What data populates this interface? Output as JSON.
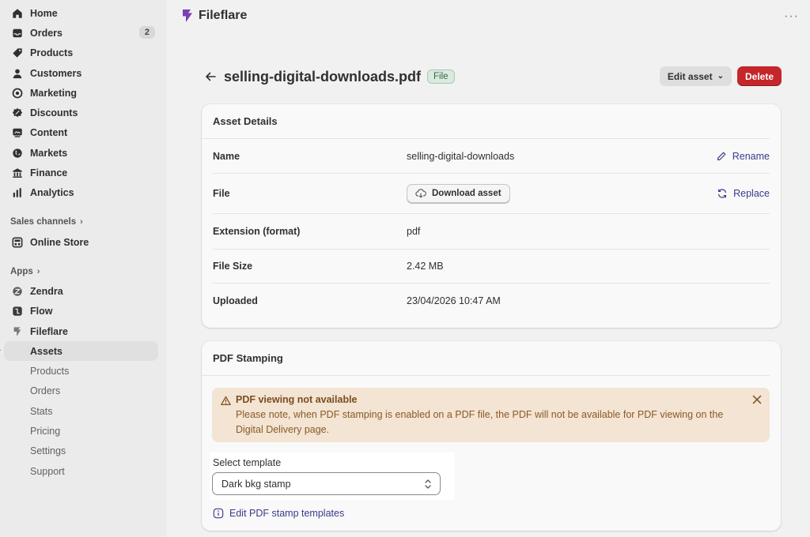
{
  "sidebar": {
    "items": [
      {
        "label": "Home",
        "icon": "home-icon"
      },
      {
        "label": "Orders",
        "icon": "inbox-icon",
        "badge": "2"
      },
      {
        "label": "Products",
        "icon": "tag-icon"
      },
      {
        "label": "Customers",
        "icon": "person-icon"
      },
      {
        "label": "Marketing",
        "icon": "target-icon"
      },
      {
        "label": "Discounts",
        "icon": "discount-icon"
      },
      {
        "label": "Content",
        "icon": "content-icon"
      },
      {
        "label": "Markets",
        "icon": "globe-icon"
      },
      {
        "label": "Finance",
        "icon": "bank-icon"
      },
      {
        "label": "Analytics",
        "icon": "bar-chart-icon"
      }
    ],
    "sales_channels_label": "Sales channels",
    "online_store_label": "Online Store",
    "apps_label": "Apps",
    "apps": [
      {
        "label": "Zendra",
        "icon": "zendra-icon"
      },
      {
        "label": "Flow",
        "icon": "flow-icon"
      },
      {
        "label": "Fileflare",
        "icon": "fileflare-icon"
      }
    ],
    "fileflare_sub": [
      "Assets",
      "Products",
      "Orders",
      "Stats",
      "Pricing",
      "Settings",
      "Support"
    ]
  },
  "topbar": {
    "app_title": "Fileflare",
    "more_label": "···"
  },
  "title_row": {
    "title": "selling-digital-downloads.pdf",
    "badge": "File",
    "edit_label": "Edit asset",
    "delete_label": "Delete"
  },
  "asset_details": {
    "heading": "Asset Details",
    "rows": [
      {
        "label": "Name",
        "value": "selling-digital-downloads",
        "action": "Rename"
      },
      {
        "label": "File",
        "button": "Download asset",
        "action": "Replace"
      },
      {
        "label": "Extension (format)",
        "value": "pdf"
      },
      {
        "label": "File Size",
        "value": "2.42 MB"
      },
      {
        "label": "Uploaded",
        "value": "23/04/2026 10:47 AM"
      }
    ]
  },
  "pdf_stamping": {
    "heading": "PDF Stamping",
    "warning_title": "PDF viewing not available",
    "warning_text": "Please note, when PDF stamping is enabled on a PDF file, the PDF will not be available for PDF viewing on the Digital Delivery page.",
    "select_label": "Select template",
    "select_value": "Dark bkg stamp",
    "edit_templates_link": "Edit PDF stamp templates"
  },
  "colors": {
    "accent_link": "#3a3a8c",
    "delete": "#c5262a",
    "warning_bg": "#f3e4d3",
    "file_badge_bg": "#dbe9df"
  }
}
